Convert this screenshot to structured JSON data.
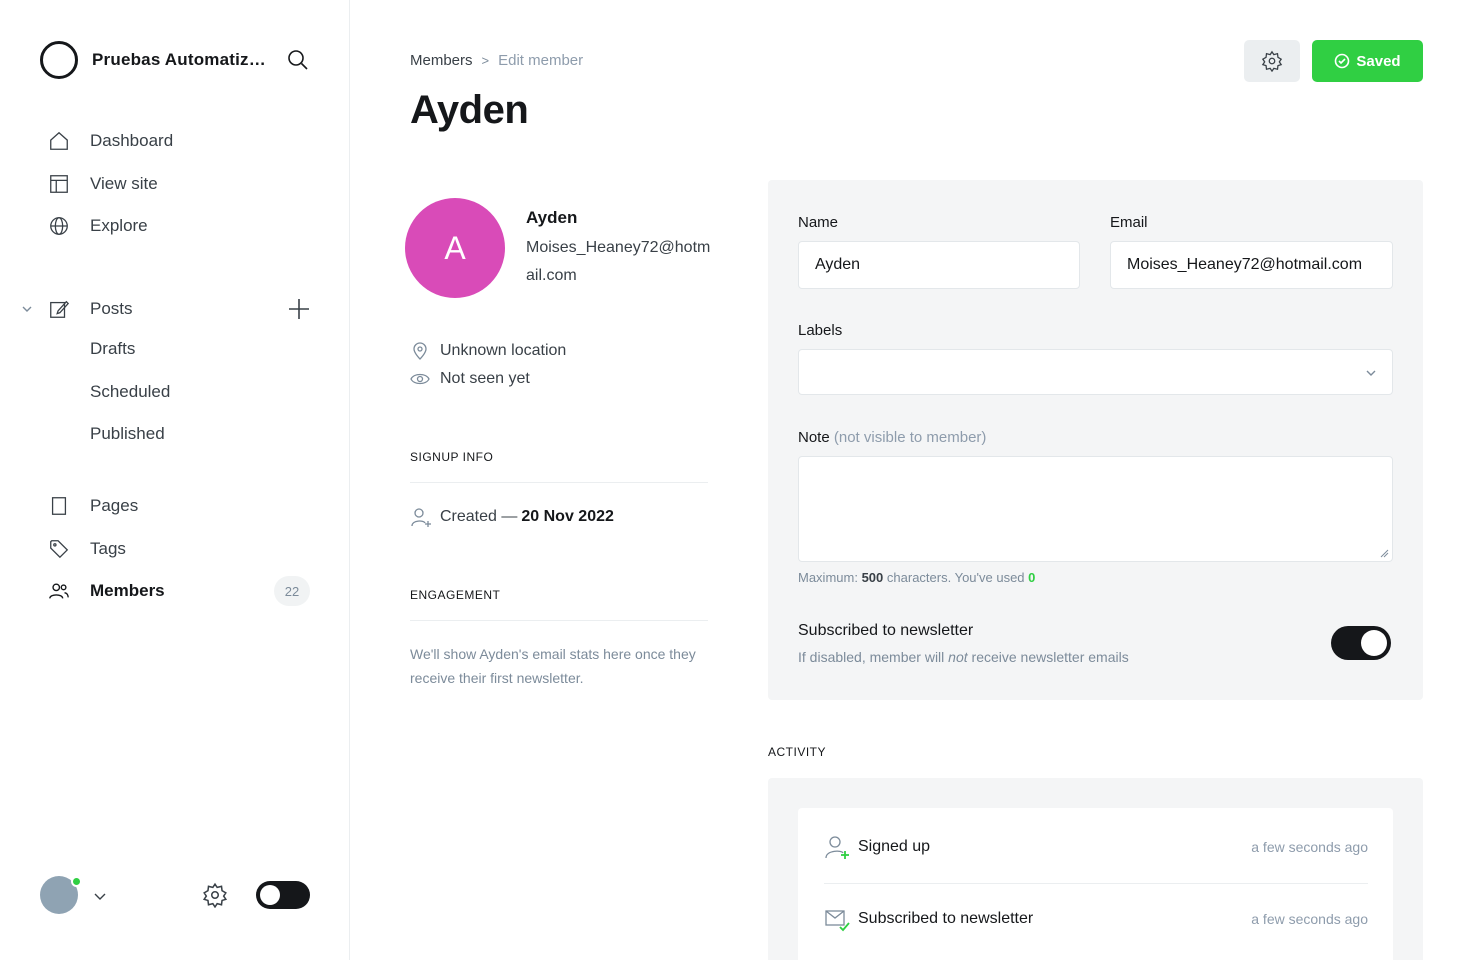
{
  "sidebar": {
    "brand_name": "Pruebas Automatizadas",
    "nav": {
      "dashboard": "Dashboard",
      "view_site": "View site",
      "explore": "Explore",
      "posts": "Posts",
      "drafts": "Drafts",
      "scheduled": "Scheduled",
      "published": "Published",
      "pages": "Pages",
      "tags": "Tags",
      "members": "Members",
      "members_count": "22"
    }
  },
  "header": {
    "breadcrumb_parent": "Members",
    "breadcrumb_separator": ">",
    "breadcrumb_current": "Edit member",
    "title": "Ayden",
    "saved_label": "Saved"
  },
  "profile": {
    "avatar_initial": "A",
    "avatar_color": "#d94bb8",
    "name": "Ayden",
    "email": "Moises_Heaney72@hotmail.com",
    "location": "Unknown location",
    "last_seen": "Not seen yet",
    "signup_heading": "SIGNUP INFO",
    "created_prefix": "Created —",
    "created_date": "20 Nov 2022",
    "engagement_heading": "ENGAGEMENT",
    "engagement_text": "We'll show Ayden's email stats here once they receive their first newsletter."
  },
  "form": {
    "name_label": "Name",
    "name_value": "Ayden",
    "email_label": "Email",
    "email_value": "Moises_Heaney72@hotmail.com",
    "labels_label": "Labels",
    "note_label": "Note",
    "note_muted": "(not visible to member)",
    "hint_prefix": "Maximum:",
    "hint_max": "500",
    "hint_middle": "characters. You've used",
    "hint_used": "0",
    "newsletter_title": "Subscribed to newsletter",
    "newsletter_desc_pre": "If disabled, member will",
    "newsletter_desc_em": "not",
    "newsletter_desc_post": "receive newsletter emails",
    "newsletter_subscribed": true
  },
  "activity": {
    "heading": "ACTIVITY",
    "items": [
      {
        "label": "Signed up",
        "time": "a few seconds ago",
        "icon": "user-add-icon"
      },
      {
        "label": "Subscribed to newsletter",
        "time": "a few seconds ago",
        "icon": "envelope-check-icon"
      }
    ]
  },
  "colors": {
    "accent_green": "#30cf43",
    "dark": "#15171a",
    "panel_bg": "#f4f5f6"
  }
}
